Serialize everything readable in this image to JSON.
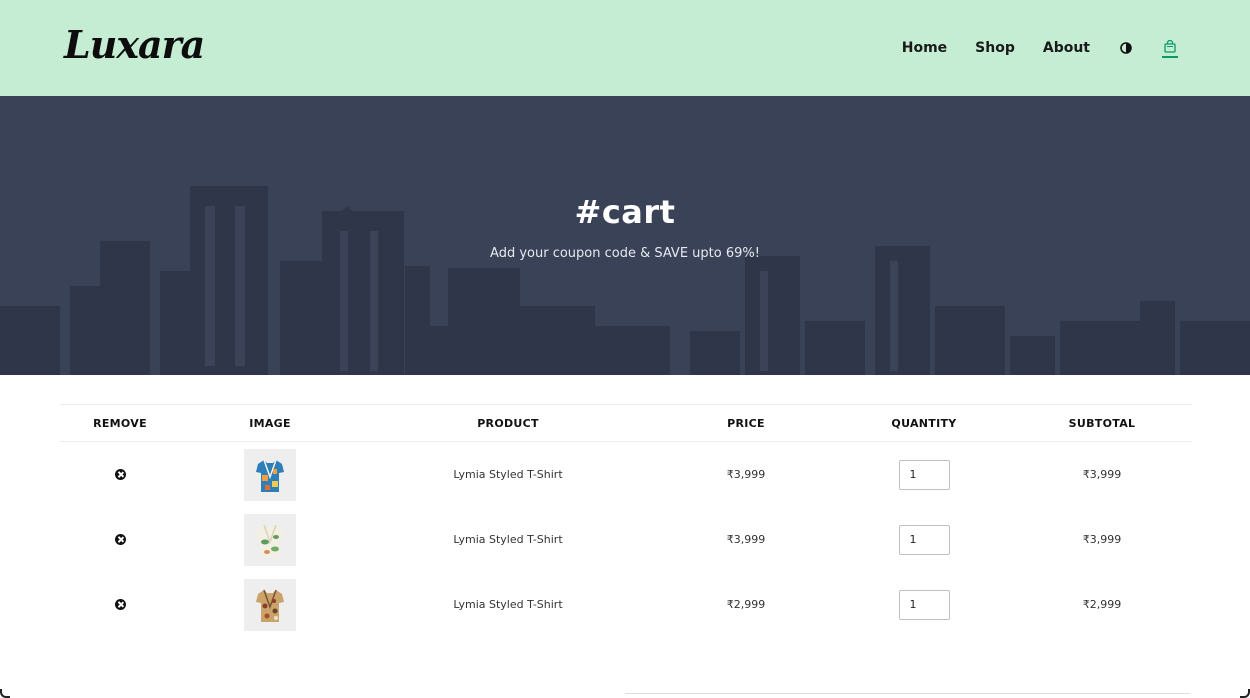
{
  "brand": {
    "logo_text": "Luxara"
  },
  "nav": {
    "items": [
      {
        "label": "Home"
      },
      {
        "label": "Shop"
      },
      {
        "label": "About"
      }
    ],
    "theme_toggle_icon": "contrast-icon",
    "cart_icon": "shopping-bag-icon",
    "accent_color": "#0a9a6a"
  },
  "hero": {
    "title": "#cart",
    "subtitle": "Add your coupon code & SAVE upto 69%!",
    "overlay_color": "#3a4258"
  },
  "cart": {
    "columns": [
      "REMOVE",
      "IMAGE",
      "PRODUCT",
      "PRICE",
      "QUANTITY",
      "SUBTOTAL"
    ],
    "rows": [
      {
        "product": "Lymia Styled T-Shirt",
        "price": "₹3,999",
        "quantity": "1",
        "subtotal": "₹3,999",
        "image_icon": "printed-shirt-blue-orange"
      },
      {
        "product": "Lymia Styled T-Shirt",
        "price": "₹3,999",
        "quantity": "1",
        "subtotal": "₹3,999",
        "image_icon": "printed-shirt-white-green"
      },
      {
        "product": "Lymia Styled T-Shirt",
        "price": "₹2,999",
        "quantity": "1",
        "subtotal": "₹2,999",
        "image_icon": "printed-shirt-brown-floral"
      }
    ]
  },
  "colors": {
    "header_bg": "#c4edd3",
    "text": "#1a1a1a"
  }
}
